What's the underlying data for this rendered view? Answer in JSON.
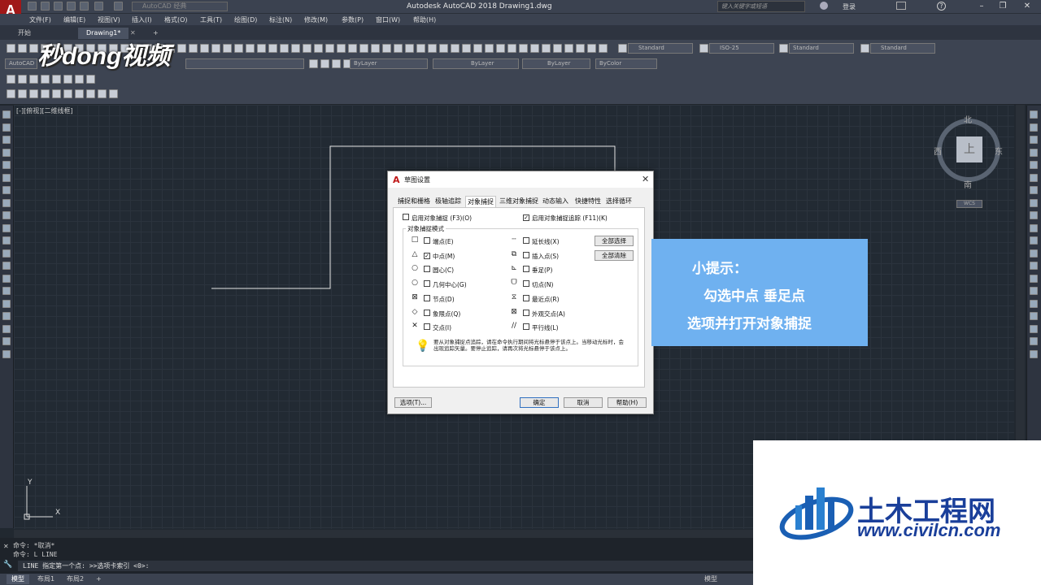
{
  "app": {
    "title": "Autodesk AutoCAD 2018    Drawing1.dwg",
    "workspace": "AutoCAD 经典",
    "search_placeholder": "键入关键字或短语",
    "login": "登录",
    "logo": "A"
  },
  "menus": [
    "文件(F)",
    "编辑(E)",
    "视图(V)",
    "插入(I)",
    "格式(O)",
    "工具(T)",
    "绘图(D)",
    "标注(N)",
    "修改(M)",
    "参数(P)",
    "窗口(W)",
    "帮助(H)"
  ],
  "file_tabs": [
    "开始",
    "Drawing1*"
  ],
  "watermark": "秒dong视频",
  "ribbon": {
    "layer_combo": "AutoCAD",
    "bylayer1": "ByLayer",
    "bylayer2": "ByLayer",
    "bylayer3": "ByLayer",
    "bycolor": "ByColor",
    "text_style": "Standard",
    "dim_style": "ISO-25",
    "table_style": "Standard",
    "mleader_style": "Standard"
  },
  "viewport_label": "[-][俯视][二维线框]",
  "viewcube": {
    "north": "北",
    "south": "南",
    "east": "东",
    "west": "西",
    "top": "上",
    "wcs": "WCS"
  },
  "ucs": {
    "x": "X",
    "y": "Y"
  },
  "dialog": {
    "title": "草图设置",
    "tabs": [
      "捕捉和栅格",
      "极轴追踪",
      "对象捕捉",
      "三维对象捕捉",
      "动态输入",
      "快捷特性",
      "选择循环"
    ],
    "enable_osnap": "启用对象捕捉 (F3)(O)",
    "enable_tracking": "启用对象捕捉追踪 (F11)(K)",
    "group_label": "对象捕捉模式",
    "left_options": [
      {
        "sym": "□",
        "label": "端点(E)",
        "checked": false
      },
      {
        "sym": "△",
        "label": "中点(M)",
        "checked": true
      },
      {
        "sym": "○",
        "label": "圆心(C)",
        "checked": false
      },
      {
        "sym": "○",
        "label": "几何中心(G)",
        "checked": false
      },
      {
        "sym": "⊠",
        "label": "节点(D)",
        "checked": false
      },
      {
        "sym": "◇",
        "label": "象限点(Q)",
        "checked": false
      },
      {
        "sym": "✕",
        "label": "交点(I)",
        "checked": false
      }
    ],
    "right_options": [
      {
        "sym": "┄",
        "label": "延长线(X)",
        "checked": false
      },
      {
        "sym": "⧉",
        "label": "插入点(S)",
        "checked": false
      },
      {
        "sym": "⊾",
        "label": "垂足(P)",
        "checked": false
      },
      {
        "sym": "ᗜ",
        "label": "切点(N)",
        "checked": false
      },
      {
        "sym": "⧖",
        "label": "最近点(R)",
        "checked": false
      },
      {
        "sym": "⊠",
        "label": "外观交点(A)",
        "checked": false
      },
      {
        "sym": "//",
        "label": "平行线(L)",
        "checked": false
      }
    ],
    "select_all": "全部选择",
    "clear_all": "全部清除",
    "hint": "要从对象捕捉点追踪，请在命令执行期间将光标悬停于该点上。当移动光标时，会出现追踪矢量。要停止追踪，请再次将光标悬停于该点上。",
    "options_btn": "选项(T)...",
    "ok": "确定",
    "cancel": "取消",
    "help": "帮助(H)"
  },
  "tip": {
    "title": "小提示：",
    "line1": "勾选中点  垂足点",
    "line2": "选项并打开对象捕捉"
  },
  "command": {
    "line1": "命令: *取消*",
    "line2": "命令: L LINE",
    "prompt": "LINE 指定第一个点:  >>选项卡索引 <0>:"
  },
  "layout_tabs": [
    "模型",
    "布局1",
    "布局2"
  ],
  "status_model": "模型",
  "brand": {
    "name": "土木工程网",
    "url": "www.civilcn.com"
  }
}
